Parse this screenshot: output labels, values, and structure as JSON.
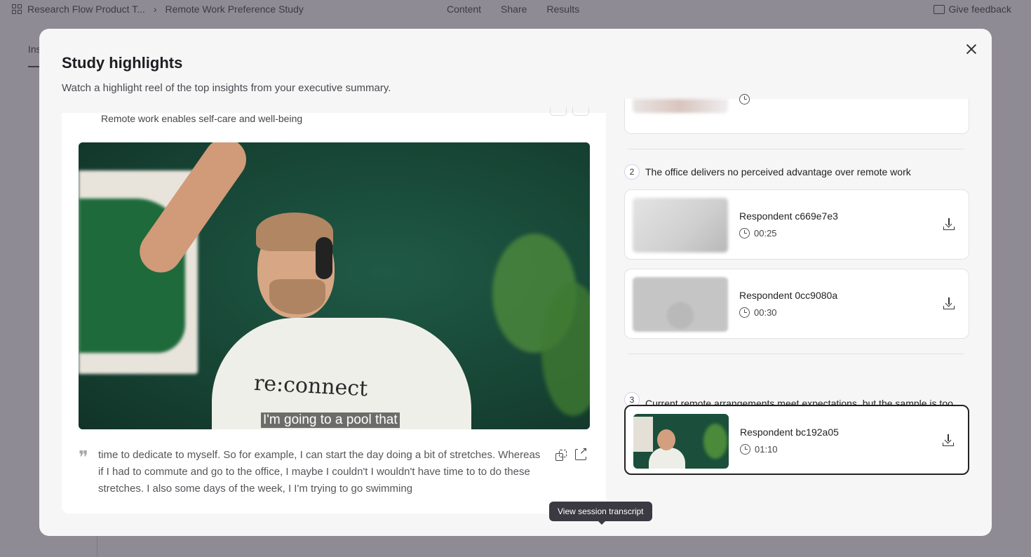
{
  "app": {
    "breadcrumb": [
      "Research Flow Product T...",
      "Remote Work Preference Study"
    ],
    "nav_tabs": [
      "Content",
      "Share",
      "Results"
    ],
    "feedback_label": "Give feedback",
    "bg_tab_label": "Ins"
  },
  "modal": {
    "title": "Study highlights",
    "subtitle": "Watch a highlight reel of the top insights from your executive summary.",
    "current_insight": "Remote work enables self-care and well-being",
    "video_caption": "I'm going to a pool that",
    "video_shirt_text": "re:connect",
    "transcript": "time to dedicate to myself. So for example, I can start the day doing a bit of stretches. Whereas if I had to commute and go to the office, I maybe I couldn't I wouldn't have time to to do these stretches. I also some days of the week, I I'm trying to go swimming",
    "tooltip": "View session transcript",
    "accent_color": "#f5a623"
  },
  "groups": [
    {
      "number": "2",
      "title": "The office delivers no perceived advantage over remote work",
      "clips": [
        {
          "respondent": "Respondent c669e7e3",
          "duration": "00:25"
        },
        {
          "respondent": "Respondent 0cc9080a",
          "duration": "00:30"
        }
      ]
    },
    {
      "number": "3",
      "title": "Current remote arrangements meet expectations, but the sample is too small to confirm broader trends",
      "clips": [
        {
          "respondent": "Respondent bc192a05",
          "duration": "01:10"
        }
      ]
    }
  ]
}
